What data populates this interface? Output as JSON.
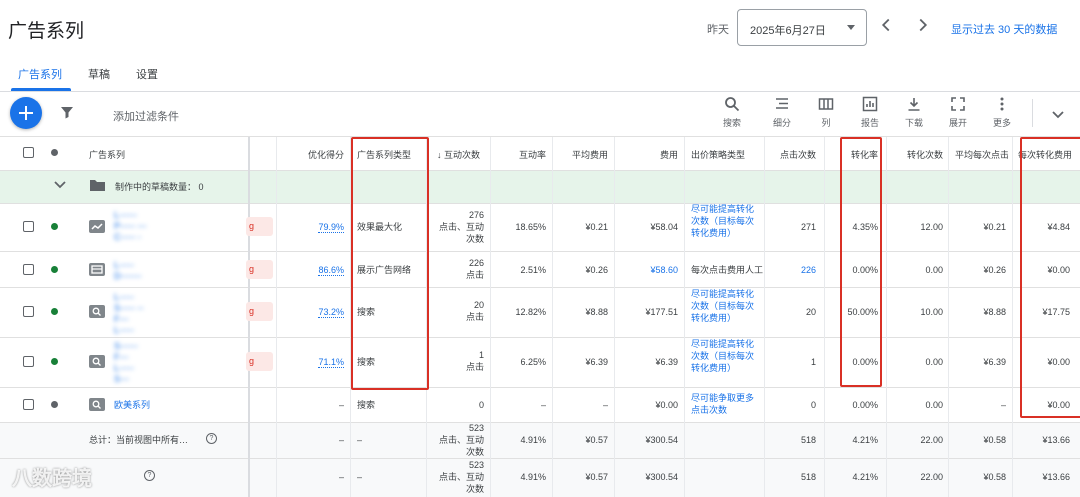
{
  "header": {
    "title": "广告系列",
    "date_label": "昨天",
    "date_value": "2025年6月27日",
    "date_link": "显示过去 30 天的数据"
  },
  "tabs": [
    {
      "label": "广告系列",
      "active": true
    },
    {
      "label": "草稿",
      "active": false
    },
    {
      "label": "设置",
      "active": false
    }
  ],
  "toolbar": {
    "filter_text": "添加过滤条件",
    "tools": [
      {
        "label": "搜索",
        "icon": "search-icon"
      },
      {
        "label": "细分",
        "icon": "segment-icon"
      },
      {
        "label": "列",
        "icon": "columns-icon"
      },
      {
        "label": "报告",
        "icon": "report-icon"
      },
      {
        "label": "下载",
        "icon": "download-icon"
      },
      {
        "label": "展开",
        "icon": "fullscreen-icon"
      },
      {
        "label": "更多",
        "icon": "more-vert-icon"
      }
    ]
  },
  "table": {
    "headers": {
      "campaign": "广告系列",
      "score": "优化得分",
      "type": "广告系列类型",
      "interactions": "↓ 互动次数",
      "interaction_rate": "互动率",
      "avg_cost": "平均费用",
      "cost": "费用",
      "bid_strategy": "出价策略类型",
      "clicks": "点击次数",
      "conv_rate": "转化率",
      "conversions": "转化次数",
      "avg_cpc": "平均每次点击",
      "cost_per_conv": "每次转化费用"
    },
    "draft_row": "制作中的草稿数量： 0",
    "rows": [
      {
        "score": "79.9%",
        "type": "效果最大化",
        "interactions": [
          "276",
          "点击、互动",
          "次数"
        ],
        "interaction_rate": "18.65%",
        "avg_cost": "¥0.21",
        "cost": "¥58.04",
        "bid_strategy": "尽可能提高转化次数（目标每次转化费用）",
        "clicks": "271",
        "conv_rate": "4.35%",
        "conversions": "12.00",
        "avg_cpc": "¥0.21",
        "cost_per_conv": "¥4.84",
        "status_color": "#188038",
        "icon": "performance-max-icon",
        "blurred_name": [
          "L------",
          "P----- ---",
          "C----- -"
        ]
      },
      {
        "score": "86.6%",
        "type": "展示广告网络",
        "interactions": [
          "226",
          "点击"
        ],
        "interaction_rate": "2.51%",
        "avg_cost": "¥0.26",
        "cost": "¥58.60",
        "bid_strategy": "每次点击费用人工出价",
        "clicks": "226",
        "conv_rate": "0.00%",
        "conversions": "0.00",
        "avg_cpc": "¥0.26",
        "cost_per_conv": "¥0.00",
        "status_color": "#188038",
        "icon": "display-icon",
        "blurred_name": [
          "L-----",
          "D-------"
        ]
      },
      {
        "score": "73.2%",
        "type": "搜索",
        "interactions": [
          "20",
          "点击"
        ],
        "interaction_rate": "12.82%",
        "avg_cost": "¥8.88",
        "cost": "¥177.51",
        "bid_strategy": "尽可能提高转化次数（目标每次转化费用）",
        "clicks": "20",
        "conv_rate": "50.00%",
        "conversions": "10.00",
        "avg_cpc": "¥8.88",
        "cost_per_conv": "¥17.75",
        "status_color": "#188038",
        "icon": "search-campaign-icon",
        "blurred_name": [
          "L-----",
          "S----- --",
          "F---",
          "L-----"
        ]
      },
      {
        "score": "71.1%",
        "type": "搜索",
        "interactions": [
          "1",
          "点击"
        ],
        "interaction_rate": "6.25%",
        "avg_cost": "¥6.39",
        "cost": "¥6.39",
        "bid_strategy": "尽可能提高转化次数（目标每次转化费用）",
        "clicks": "1",
        "conv_rate": "0.00%",
        "conversions": "0.00",
        "avg_cpc": "¥6.39",
        "cost_per_conv": "¥0.00",
        "status_color": "#188038",
        "icon": "search-campaign-icon",
        "blurred_name": [
          "S------",
          "F---",
          "L-----",
          "S---"
        ]
      },
      {
        "name": "欧美系列",
        "score": "–",
        "type": "搜索",
        "interactions": [
          "0"
        ],
        "interaction_rate": "–",
        "avg_cost": "–",
        "cost": "¥0.00",
        "bid_strategy": "尽可能争取更多点击次数",
        "clicks": "0",
        "conv_rate": "0.00%",
        "conversions": "0.00",
        "avg_cpc": "–",
        "cost_per_conv": "¥0.00",
        "status_color": "#5f6368",
        "icon": "search-campaign-icon"
      }
    ],
    "totals": [
      {
        "label": "总计：当前视图中所有…",
        "score": "–",
        "type": "–",
        "interactions": [
          "523",
          "点击、互动",
          "次数"
        ],
        "interaction_rate": "4.91%",
        "avg_cost": "¥0.57",
        "cost": "¥300.54",
        "bid_strategy": "",
        "clicks": "518",
        "conv_rate": "4.21%",
        "conversions": "22.00",
        "avg_cpc": "¥0.58",
        "cost_per_conv": "¥13.66"
      },
      {
        "label": "",
        "score": "–",
        "type": "–",
        "interactions": [
          "523",
          "点击、互动",
          "次数"
        ],
        "interaction_rate": "4.91%",
        "avg_cost": "¥0.57",
        "cost": "¥300.54",
        "bid_strategy": "",
        "clicks": "518",
        "conv_rate": "4.21%",
        "conversions": "22.00",
        "avg_cpc": "¥0.58",
        "cost_per_conv": "¥13.66"
      }
    ]
  },
  "watermark": "八数跨境",
  "colors": {
    "accent": "#1a73e8",
    "highlight": "#d93025",
    "draft_bg": "#e6f4ea"
  }
}
